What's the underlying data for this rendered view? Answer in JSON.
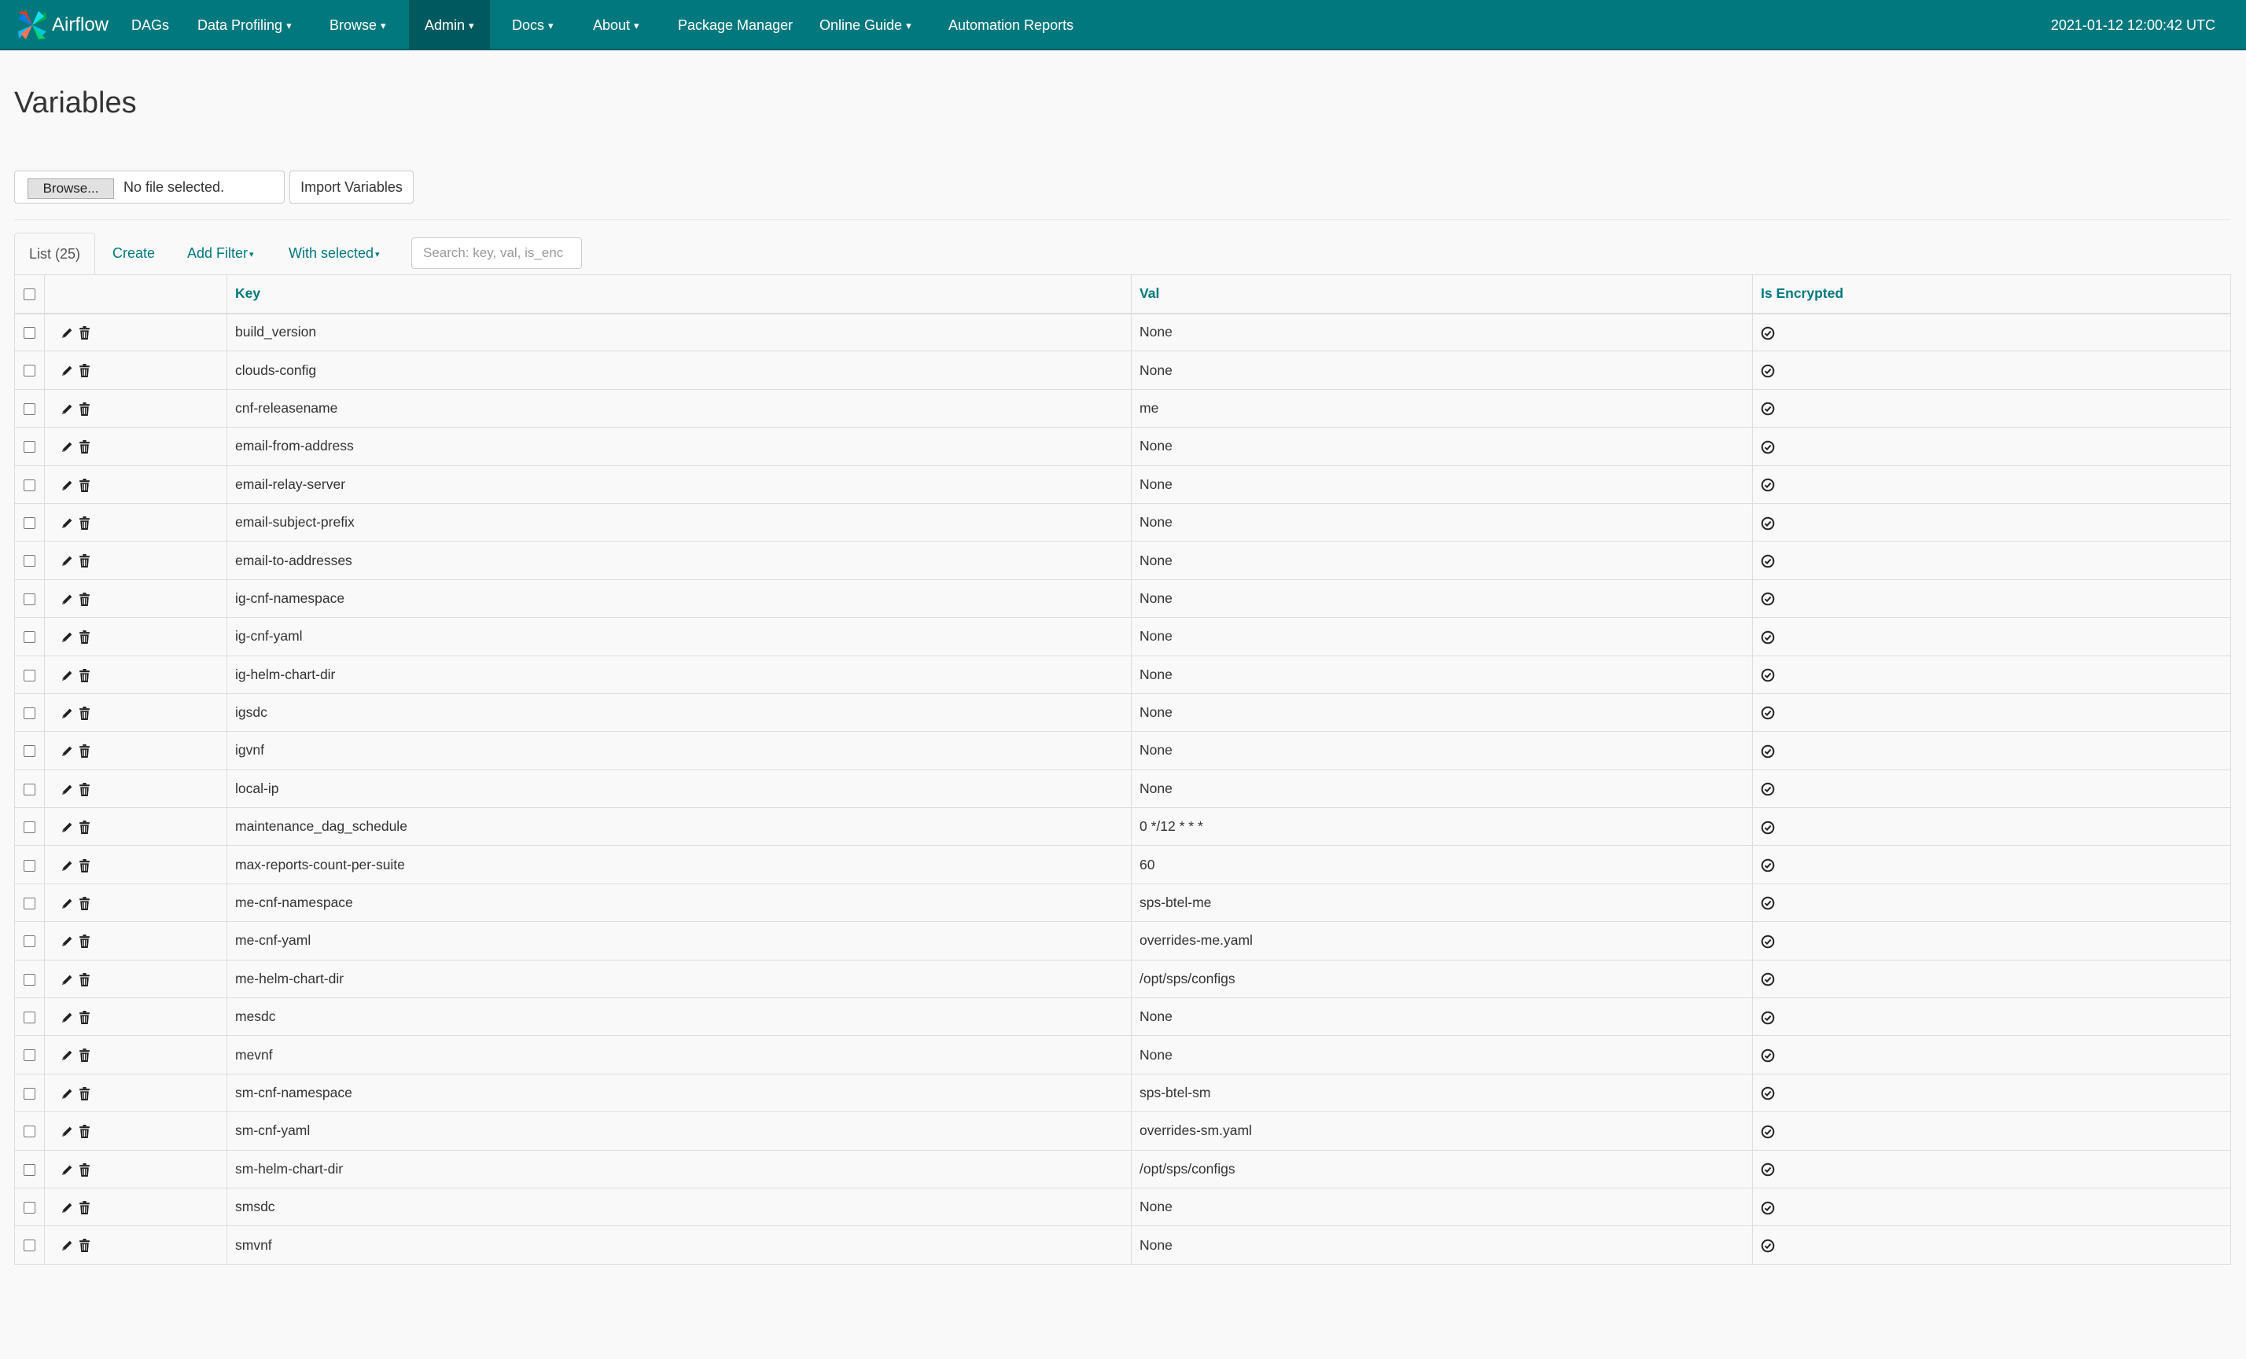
{
  "nav": {
    "brand": "Airflow",
    "items": [
      {
        "label": "DAGs",
        "caret": ""
      },
      {
        "label": "Data Profiling",
        "caret": "▾"
      },
      {
        "label": "Browse",
        "caret": "▾"
      },
      {
        "label": "Admin",
        "caret": "▾"
      },
      {
        "label": "Docs",
        "caret": "▾"
      },
      {
        "label": "About",
        "caret": "▾"
      },
      {
        "label": "Package Manager",
        "caret": ""
      },
      {
        "label": "Online Guide",
        "caret": "▾"
      },
      {
        "label": "Automation Reports",
        "caret": ""
      }
    ],
    "active": "Admin",
    "clock": "2021-01-12 12:00:42 UTC",
    "accent_color": "#00787e"
  },
  "page": {
    "title": "Variables"
  },
  "import": {
    "browse_label": "Browse...",
    "file_status": "No file selected.",
    "import_label": "Import Variables"
  },
  "tabs": {
    "list": "List (25)",
    "create": "Create",
    "add_filter": "Add Filter",
    "with_selected": "With selected",
    "caret": "▾"
  },
  "search": {
    "placeholder": "Search: key, val, is_enc"
  },
  "table": {
    "columns": {
      "key": "Key",
      "val": "Val",
      "is_encrypted": "Is Encrypted"
    },
    "rows": [
      {
        "key": "build_version",
        "val": "None",
        "encrypted": true
      },
      {
        "key": "clouds-config",
        "val": "None",
        "encrypted": true
      },
      {
        "key": "cnf-releasename",
        "val": "me",
        "encrypted": true
      },
      {
        "key": "email-from-address",
        "val": "None",
        "encrypted": true
      },
      {
        "key": "email-relay-server",
        "val": "None",
        "encrypted": true
      },
      {
        "key": "email-subject-prefix",
        "val": "None",
        "encrypted": true
      },
      {
        "key": "email-to-addresses",
        "val": "None",
        "encrypted": true
      },
      {
        "key": "ig-cnf-namespace",
        "val": "None",
        "encrypted": true
      },
      {
        "key": "ig-cnf-yaml",
        "val": "None",
        "encrypted": true
      },
      {
        "key": "ig-helm-chart-dir",
        "val": "None",
        "encrypted": true
      },
      {
        "key": "igsdc",
        "val": "None",
        "encrypted": true
      },
      {
        "key": "igvnf",
        "val": "None",
        "encrypted": true
      },
      {
        "key": "local-ip",
        "val": "None",
        "encrypted": true
      },
      {
        "key": "maintenance_dag_schedule",
        "val": "0 */12 * * *",
        "encrypted": true
      },
      {
        "key": "max-reports-count-per-suite",
        "val": "60",
        "encrypted": true
      },
      {
        "key": "me-cnf-namespace",
        "val": "sps-btel-me",
        "encrypted": true
      },
      {
        "key": "me-cnf-yaml",
        "val": "overrides-me.yaml",
        "encrypted": true
      },
      {
        "key": "me-helm-chart-dir",
        "val": "/opt/sps/configs",
        "encrypted": true
      },
      {
        "key": "mesdc",
        "val": "None",
        "encrypted": true
      },
      {
        "key": "mevnf",
        "val": "None",
        "encrypted": true
      },
      {
        "key": "sm-cnf-namespace",
        "val": "sps-btel-sm",
        "encrypted": true
      },
      {
        "key": "sm-cnf-yaml",
        "val": "overrides-sm.yaml",
        "encrypted": true
      },
      {
        "key": "sm-helm-chart-dir",
        "val": "/opt/sps/configs",
        "encrypted": true
      },
      {
        "key": "smsdc",
        "val": "None",
        "encrypted": true
      },
      {
        "key": "smvnf",
        "val": "None",
        "encrypted": true
      }
    ]
  }
}
